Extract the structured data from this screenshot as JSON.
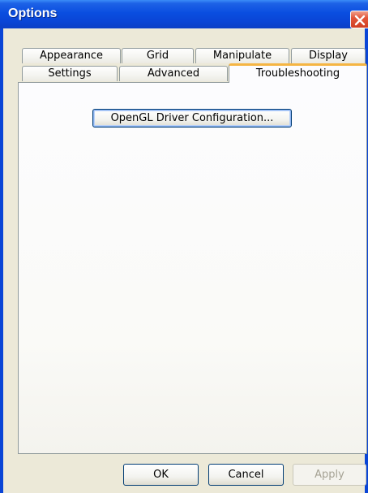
{
  "window": {
    "title": "Options"
  },
  "tabs": {
    "row_back": [
      "Appearance",
      "Grid",
      "Manipulate",
      "Display"
    ],
    "row_front": [
      "Settings",
      "Advanced",
      "Troubleshooting"
    ],
    "selected": "Troubleshooting"
  },
  "panel": {
    "opengl_button_label": "OpenGL Driver Configuration..."
  },
  "footer": {
    "ok_label": "OK",
    "cancel_label": "Cancel",
    "apply_label": "Apply"
  },
  "colors": {
    "titlebar": "#0a4ee0",
    "selected_tab_accent": "#f5b543",
    "dialog_bg": "#ece9d8",
    "close_button": "#e2563a"
  }
}
